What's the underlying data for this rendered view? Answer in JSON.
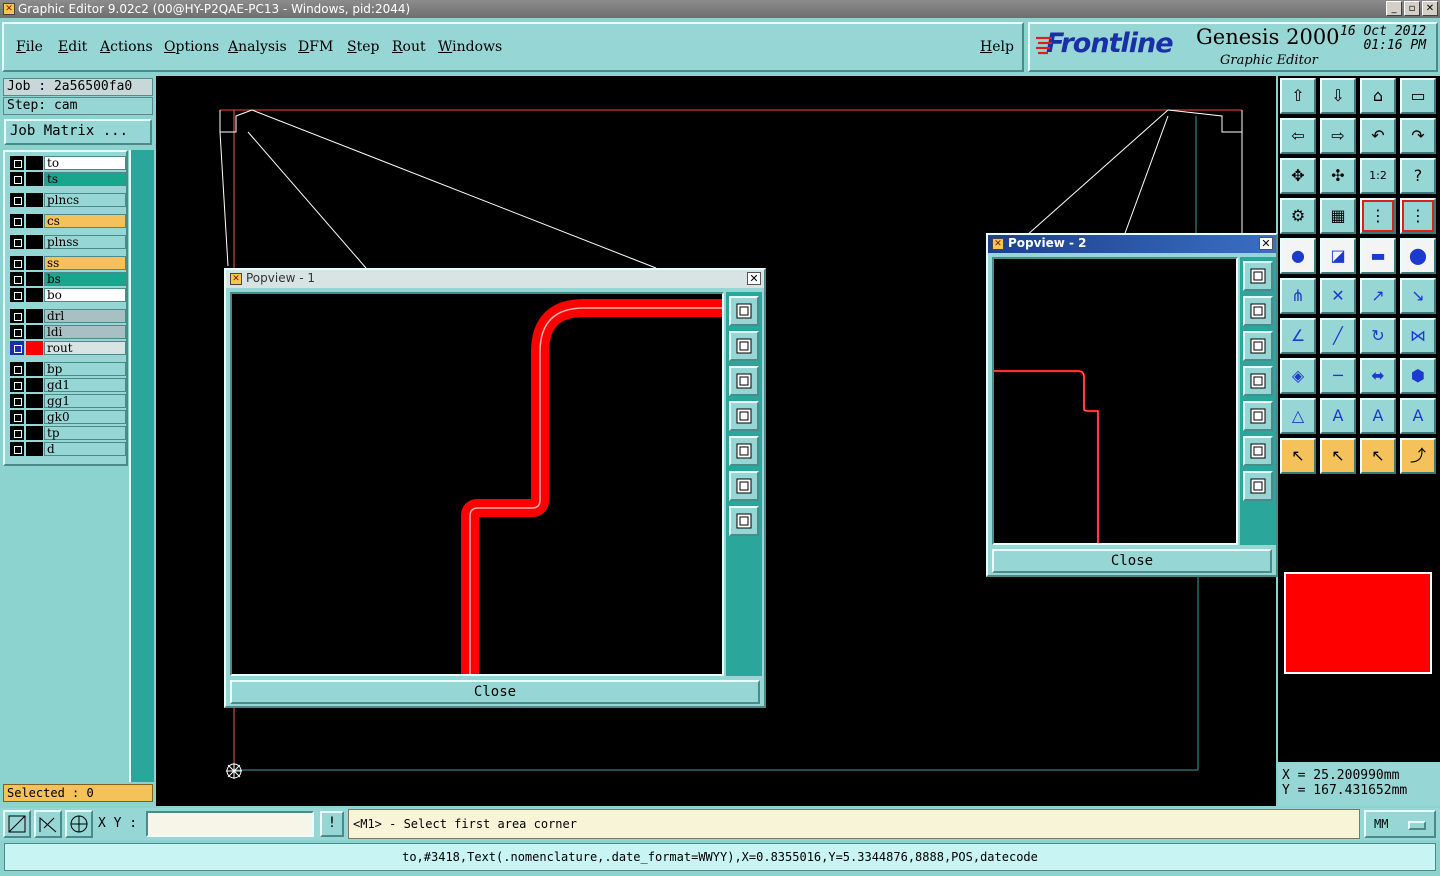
{
  "window": {
    "title": "Graphic Editor 9.02c2 (00@HY-P2QAE-PC13 - Windows, pid:2044)"
  },
  "menu": {
    "items": [
      "File",
      "Edit",
      "Actions",
      "Options",
      "Analysis",
      "DFM",
      "Step",
      "Rout",
      "Windows"
    ],
    "help": "Help"
  },
  "brand": {
    "logo": "Frontline",
    "product": "Genesis 2000",
    "subtitle": "Graphic Editor",
    "date": "16 Oct 2012",
    "time": "01:16 PM"
  },
  "job": {
    "label": "Job : 2a56500fa0",
    "step": "Step: cam",
    "matrix_button": "Job Matrix ..."
  },
  "layers": [
    {
      "name": "to",
      "color": "#ffffff",
      "marker": "✎"
    },
    {
      "name": "ts",
      "color": "#1aa58e"
    },
    {
      "name": "plncs",
      "color": "#96d6d4"
    },
    {
      "name": "cs",
      "color": "#f4c15a"
    },
    {
      "name": "plnss",
      "color": "#96d6d4"
    },
    {
      "name": "ss",
      "color": "#f4c15a"
    },
    {
      "name": "bs",
      "color": "#1aa58e"
    },
    {
      "name": "bo",
      "color": "#ffffff"
    },
    {
      "name": "drl",
      "color": "#a8c0c4"
    },
    {
      "name": "ldi",
      "color": "#a8c0c4"
    },
    {
      "name": "rout",
      "color": "#d8e4e4",
      "active": true,
      "swatch": "#ff0000",
      "marker": "▦"
    },
    {
      "name": "bp",
      "color": "#96d6d4"
    },
    {
      "name": "gd1",
      "color": "#96d6d4",
      "marker": "✎"
    },
    {
      "name": "gg1",
      "color": "#96d6d4"
    },
    {
      "name": "gk0",
      "color": "#96d6d4"
    },
    {
      "name": "tp",
      "color": "#96d6d4"
    },
    {
      "name": "d",
      "color": "#96d6d4"
    }
  ],
  "selection": {
    "text": "Selected : 0"
  },
  "popview1": {
    "title": "Popview - 1",
    "close": "Close"
  },
  "popview2": {
    "title": "Popview - 2",
    "close": "Close"
  },
  "coords": {
    "x": "X = 25.200990mm",
    "y": "Y = 167.431652mm"
  },
  "bottom": {
    "xy_label": "X Y :",
    "xy_value": "",
    "exclaim": "!",
    "prompt": "<M1> - Select first area corner",
    "units": "MM"
  },
  "status": {
    "text": "to,#3418,Text(.nomenclature,.date_format=WWYY),X=0.8355016,Y=5.3344876,8888,POS,datecode"
  },
  "colors": {
    "accent": "#96d6d4",
    "trace_red": "#ff0000",
    "frontline_blue": "#1a2ea8"
  },
  "tool_icons": [
    "pan-up-icon",
    "pan-down-icon",
    "home-icon",
    "window-icon",
    "pan-left-icon",
    "pan-right-icon",
    "undo-icon",
    "redo-icon",
    "zoom-fit-icon",
    "zoom-center-icon",
    "scale-icon",
    "help-icon",
    "settings-icon",
    "grid-icon",
    "snap-icon",
    "snap-alt-icon",
    "pad-add-icon",
    "line-add-icon",
    "ruler-icon",
    "circle-icon",
    "node-icon",
    "cross-icon",
    "move-icon",
    "copy-icon",
    "angle-icon",
    "slope-icon",
    "arc-icon",
    "mirror-icon",
    "pad-move-icon",
    "split-icon",
    "measure-icon",
    "pad-group-icon",
    "triangle-icon",
    "text-a-icon",
    "text-b-icon",
    "text-c-icon",
    "pointer-icon",
    "pointer-box-icon",
    "pointer-sel-icon",
    "connect-icon"
  ]
}
